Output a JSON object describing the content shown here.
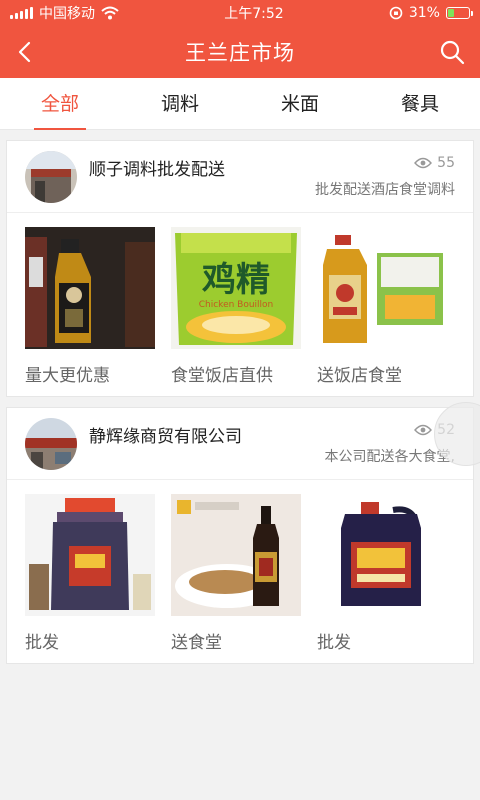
{
  "status_bar": {
    "carrier": "中国移动",
    "time": "上午7:52",
    "battery_percent": "31%",
    "battery_level": 0.31
  },
  "header": {
    "title": "王兰庄市场"
  },
  "tabs": [
    {
      "label": "全部",
      "active": true
    },
    {
      "label": "调料",
      "active": false
    },
    {
      "label": "米面",
      "active": false
    },
    {
      "label": "餐具",
      "active": false
    }
  ],
  "shops": [
    {
      "name": "顺子调料批发配送",
      "views": "55",
      "description": "批发配送酒店食堂调料",
      "products": [
        {
          "label": "量大更优惠"
        },
        {
          "label": "食堂饭店直供",
          "image_text": "鸡精",
          "image_subtext": "Chicken Bouillon"
        },
        {
          "label": "送饭店食堂"
        }
      ]
    },
    {
      "name": "静辉缘商贸有限公司",
      "views": "52",
      "description": "本公司配送各大食堂,",
      "products": [
        {
          "label": "批发"
        },
        {
          "label": "送食堂"
        },
        {
          "label": "批发"
        }
      ]
    }
  ],
  "colors": {
    "accent": "#f0553f",
    "battery_fill": "#7ee35a"
  }
}
